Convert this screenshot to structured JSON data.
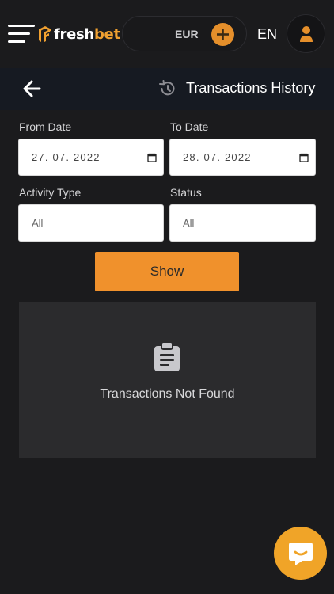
{
  "header": {
    "logo": {
      "text_main": "fresh",
      "text_accent": "bet"
    },
    "balance": {
      "currency": "EUR"
    },
    "language": "EN",
    "icons": {
      "menu": "hamburger-menu-icon",
      "deposit": "plus-icon",
      "profile": "user-icon"
    },
    "colors": {
      "accent": "#f0912c",
      "deposit_button": "#e58f2b"
    }
  },
  "titlebar": {
    "title": "Transactions History",
    "icons": {
      "back": "arrow-left-icon",
      "history": "history-icon"
    }
  },
  "filters": {
    "from_date": {
      "label": "From Date",
      "value": "27. 07. 2022"
    },
    "to_date": {
      "label": "To Date",
      "value": "28. 07. 2022"
    },
    "activity_type": {
      "label": "Activity Type",
      "value": "All"
    },
    "status": {
      "label": "Status",
      "value": "All"
    },
    "show_button": "Show"
  },
  "results": {
    "empty_message": "Transactions Not Found",
    "icon": "clipboard-icon"
  },
  "chat": {
    "icon": "chat-bubble-icon",
    "color": "#f0a428"
  }
}
